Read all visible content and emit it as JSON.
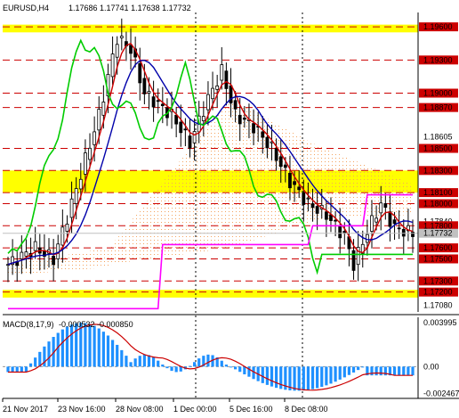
{
  "header": {
    "symbol_tf": "EURUSD,H4",
    "ohlc": "1.17686 1.17741 1.17638 1.17732"
  },
  "macd": {
    "label": "MACD(8,17,9)",
    "values": "-0.000532 -0.000850",
    "axis": [
      {
        "text": "0.003995",
        "v": 0.003995
      },
      {
        "text": "0.00",
        "v": 0.0
      },
      {
        "text": "-0.002467",
        "v": -0.002467
      }
    ]
  },
  "price_axis": [
    {
      "text": "1.19600",
      "v": 1.196,
      "boxed": true
    },
    {
      "text": "1.19300",
      "v": 1.193,
      "boxed": true
    },
    {
      "text": "1.19000",
      "v": 1.19,
      "boxed": true
    },
    {
      "text": "1.18870",
      "v": 1.1887,
      "boxed": true
    },
    {
      "text": "1.18605",
      "v": 1.18605,
      "boxed": false
    },
    {
      "text": "1.18500",
      "v": 1.185,
      "boxed": true
    },
    {
      "text": "1.18300",
      "v": 1.183,
      "boxed": true
    },
    {
      "text": "1.18100",
      "v": 1.181,
      "boxed": true
    },
    {
      "text": "1.18000",
      "v": 1.18,
      "boxed": true
    },
    {
      "text": "1.17840",
      "v": 1.1784,
      "boxed": false
    },
    {
      "text": "1.17800",
      "v": 1.178,
      "boxed": true
    },
    {
      "text": "1.17732",
      "v": 1.17732,
      "boxed": false,
      "current": true
    },
    {
      "text": "1.17600",
      "v": 1.176,
      "boxed": true
    },
    {
      "text": "1.17500",
      "v": 1.175,
      "boxed": true
    },
    {
      "text": "1.17300",
      "v": 1.173,
      "boxed": true
    },
    {
      "text": "1.17200",
      "v": 1.172,
      "boxed": true
    },
    {
      "text": "1.17080",
      "v": 1.1708,
      "boxed": false
    }
  ],
  "time_axis": [
    "21 Nov 2017",
    "23 Nov 16:00",
    "28 Nov 08:00",
    "1 Dec 00:00",
    "5 Dec 16:00",
    "8 Dec 08:00"
  ],
  "levels": [
    1.196,
    1.193,
    1.19,
    1.1887,
    1.185,
    1.183,
    1.181,
    1.18,
    1.178,
    1.176,
    1.175,
    1.173,
    1.172
  ],
  "yellow_zones": [
    [
      1.1955,
      1.1962
    ],
    [
      1.181,
      1.183
    ],
    [
      1.1715,
      1.1722
    ]
  ],
  "colors": {
    "background": "#ffffff",
    "candle": "#000000",
    "level_line": "#cc0000",
    "yellow_zone": "#ffff00",
    "current_price": "#c0c0c0",
    "tenkan": "#cc0000",
    "kijun": "#0000aa",
    "chikou": "#00cc00",
    "kumo": "#f4a460",
    "magenta": "#ff00ff",
    "macd_hist": "#1e90ff",
    "macd_signal": "#cc0000"
  },
  "chart_data": {
    "type": "line",
    "price_range": [
      1.1702,
      1.1973
    ],
    "macd_range": [
      -0.0029,
      0.0045
    ]
  }
}
